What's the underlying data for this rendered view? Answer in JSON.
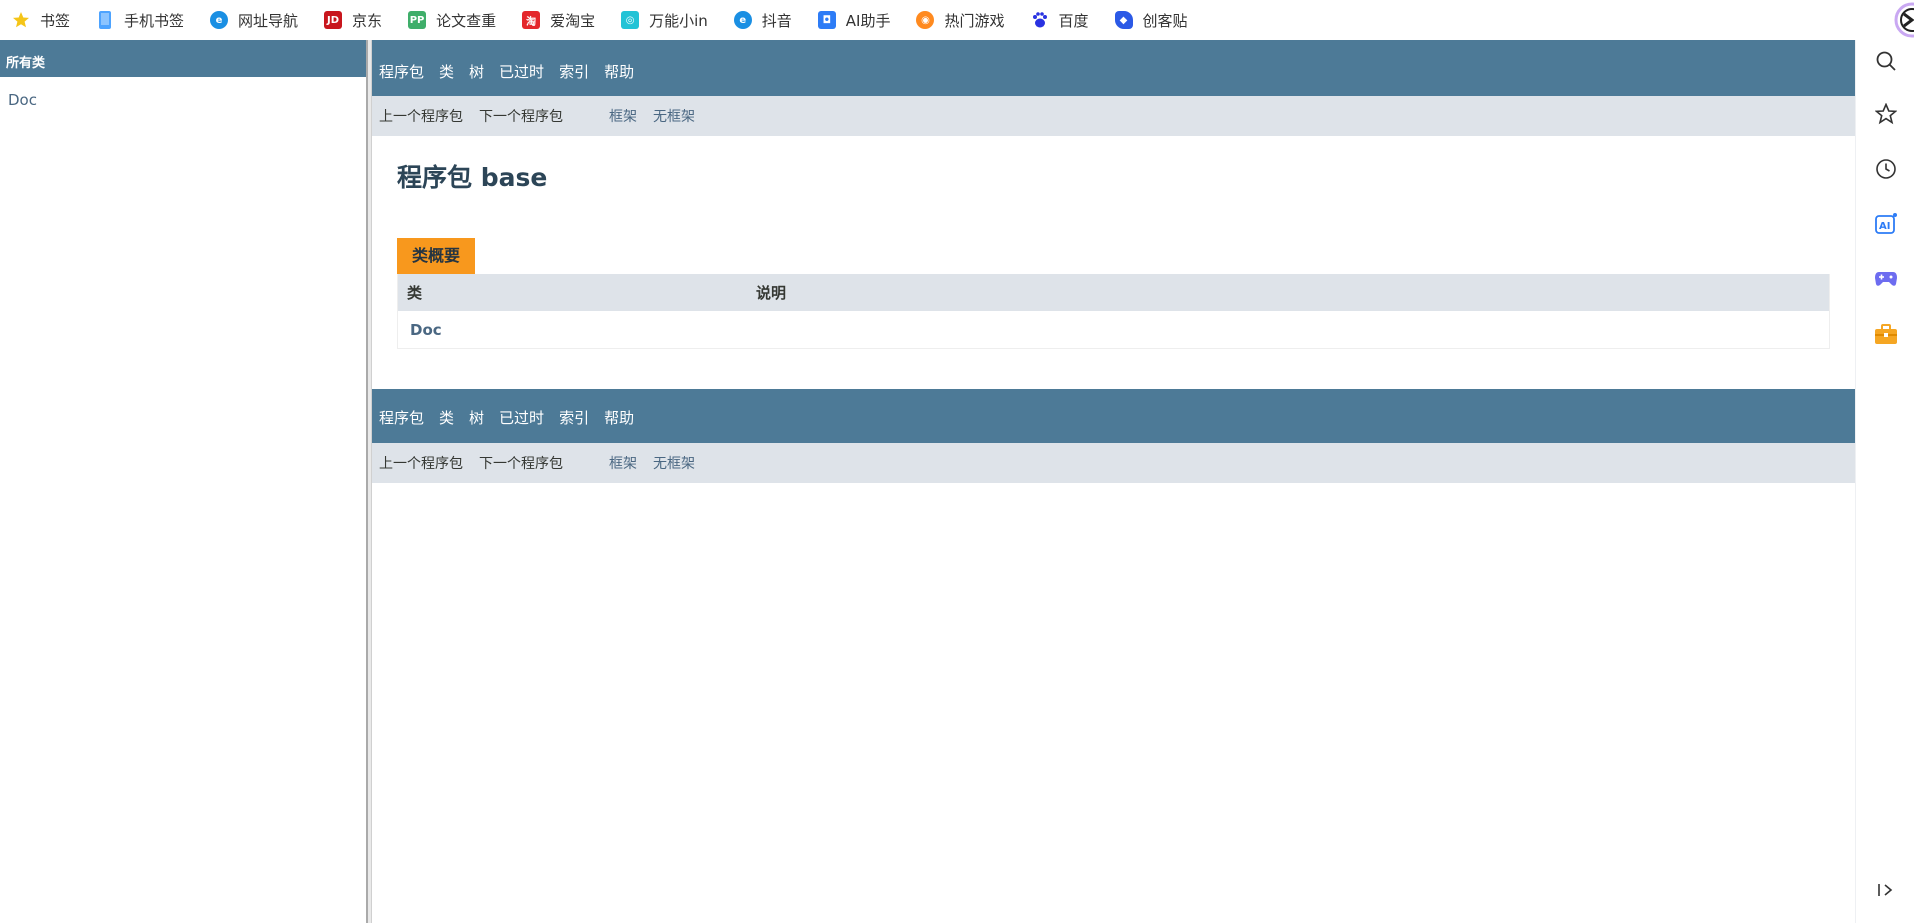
{
  "bookmarks": [
    {
      "label": "书签",
      "icon": "star-icon",
      "color": "#f5c518"
    },
    {
      "label": "手机书签",
      "icon": "phone-icon",
      "color": "#4da3ff"
    },
    {
      "label": "网址导航",
      "icon": "browser-e-icon",
      "color": "#1a8fe3"
    },
    {
      "label": "京东",
      "icon": "jd-icon",
      "color": "#c8161d"
    },
    {
      "label": "论文查重",
      "icon": "pp-icon",
      "color": "#3fae6a"
    },
    {
      "label": "爱淘宝",
      "icon": "taobao-icon",
      "color": "#e4272b"
    },
    {
      "label": "万能小in",
      "icon": "robot-icon",
      "color": "#22c3d6"
    },
    {
      "label": "抖音",
      "icon": "browser-e-icon",
      "color": "#1a8fe3"
    },
    {
      "label": "AI助手",
      "icon": "ai-assistant-icon",
      "color": "#2d7cf6"
    },
    {
      "label": "热门游戏",
      "icon": "game-icon",
      "color": "#ff8a1f"
    },
    {
      "label": "百度",
      "icon": "baidu-paw-icon",
      "color": "#2932e1"
    },
    {
      "label": "创客贴",
      "icon": "chuangkit-icon",
      "color": "#2b59e6"
    }
  ],
  "left_frame": {
    "header": "所有类",
    "classes": [
      "Doc"
    ]
  },
  "top_nav": {
    "items": [
      "程序包",
      "类",
      "树",
      "已过时",
      "索引",
      "帮助"
    ]
  },
  "sub_nav": {
    "prev": "上一个程序包",
    "next": "下一个程序包",
    "frames": "框架",
    "no_frames": "无框架"
  },
  "page": {
    "title": "程序包 base"
  },
  "class_summary": {
    "caption": "类概要",
    "col_class": "类",
    "col_desc": "说明",
    "rows": [
      {
        "name": "Doc",
        "desc": ""
      }
    ]
  },
  "colors": {
    "nav_bg": "#4d7a97",
    "subnav_bg": "#dee3e9",
    "caption_bg": "#f8981d",
    "link": "#4a6782"
  }
}
